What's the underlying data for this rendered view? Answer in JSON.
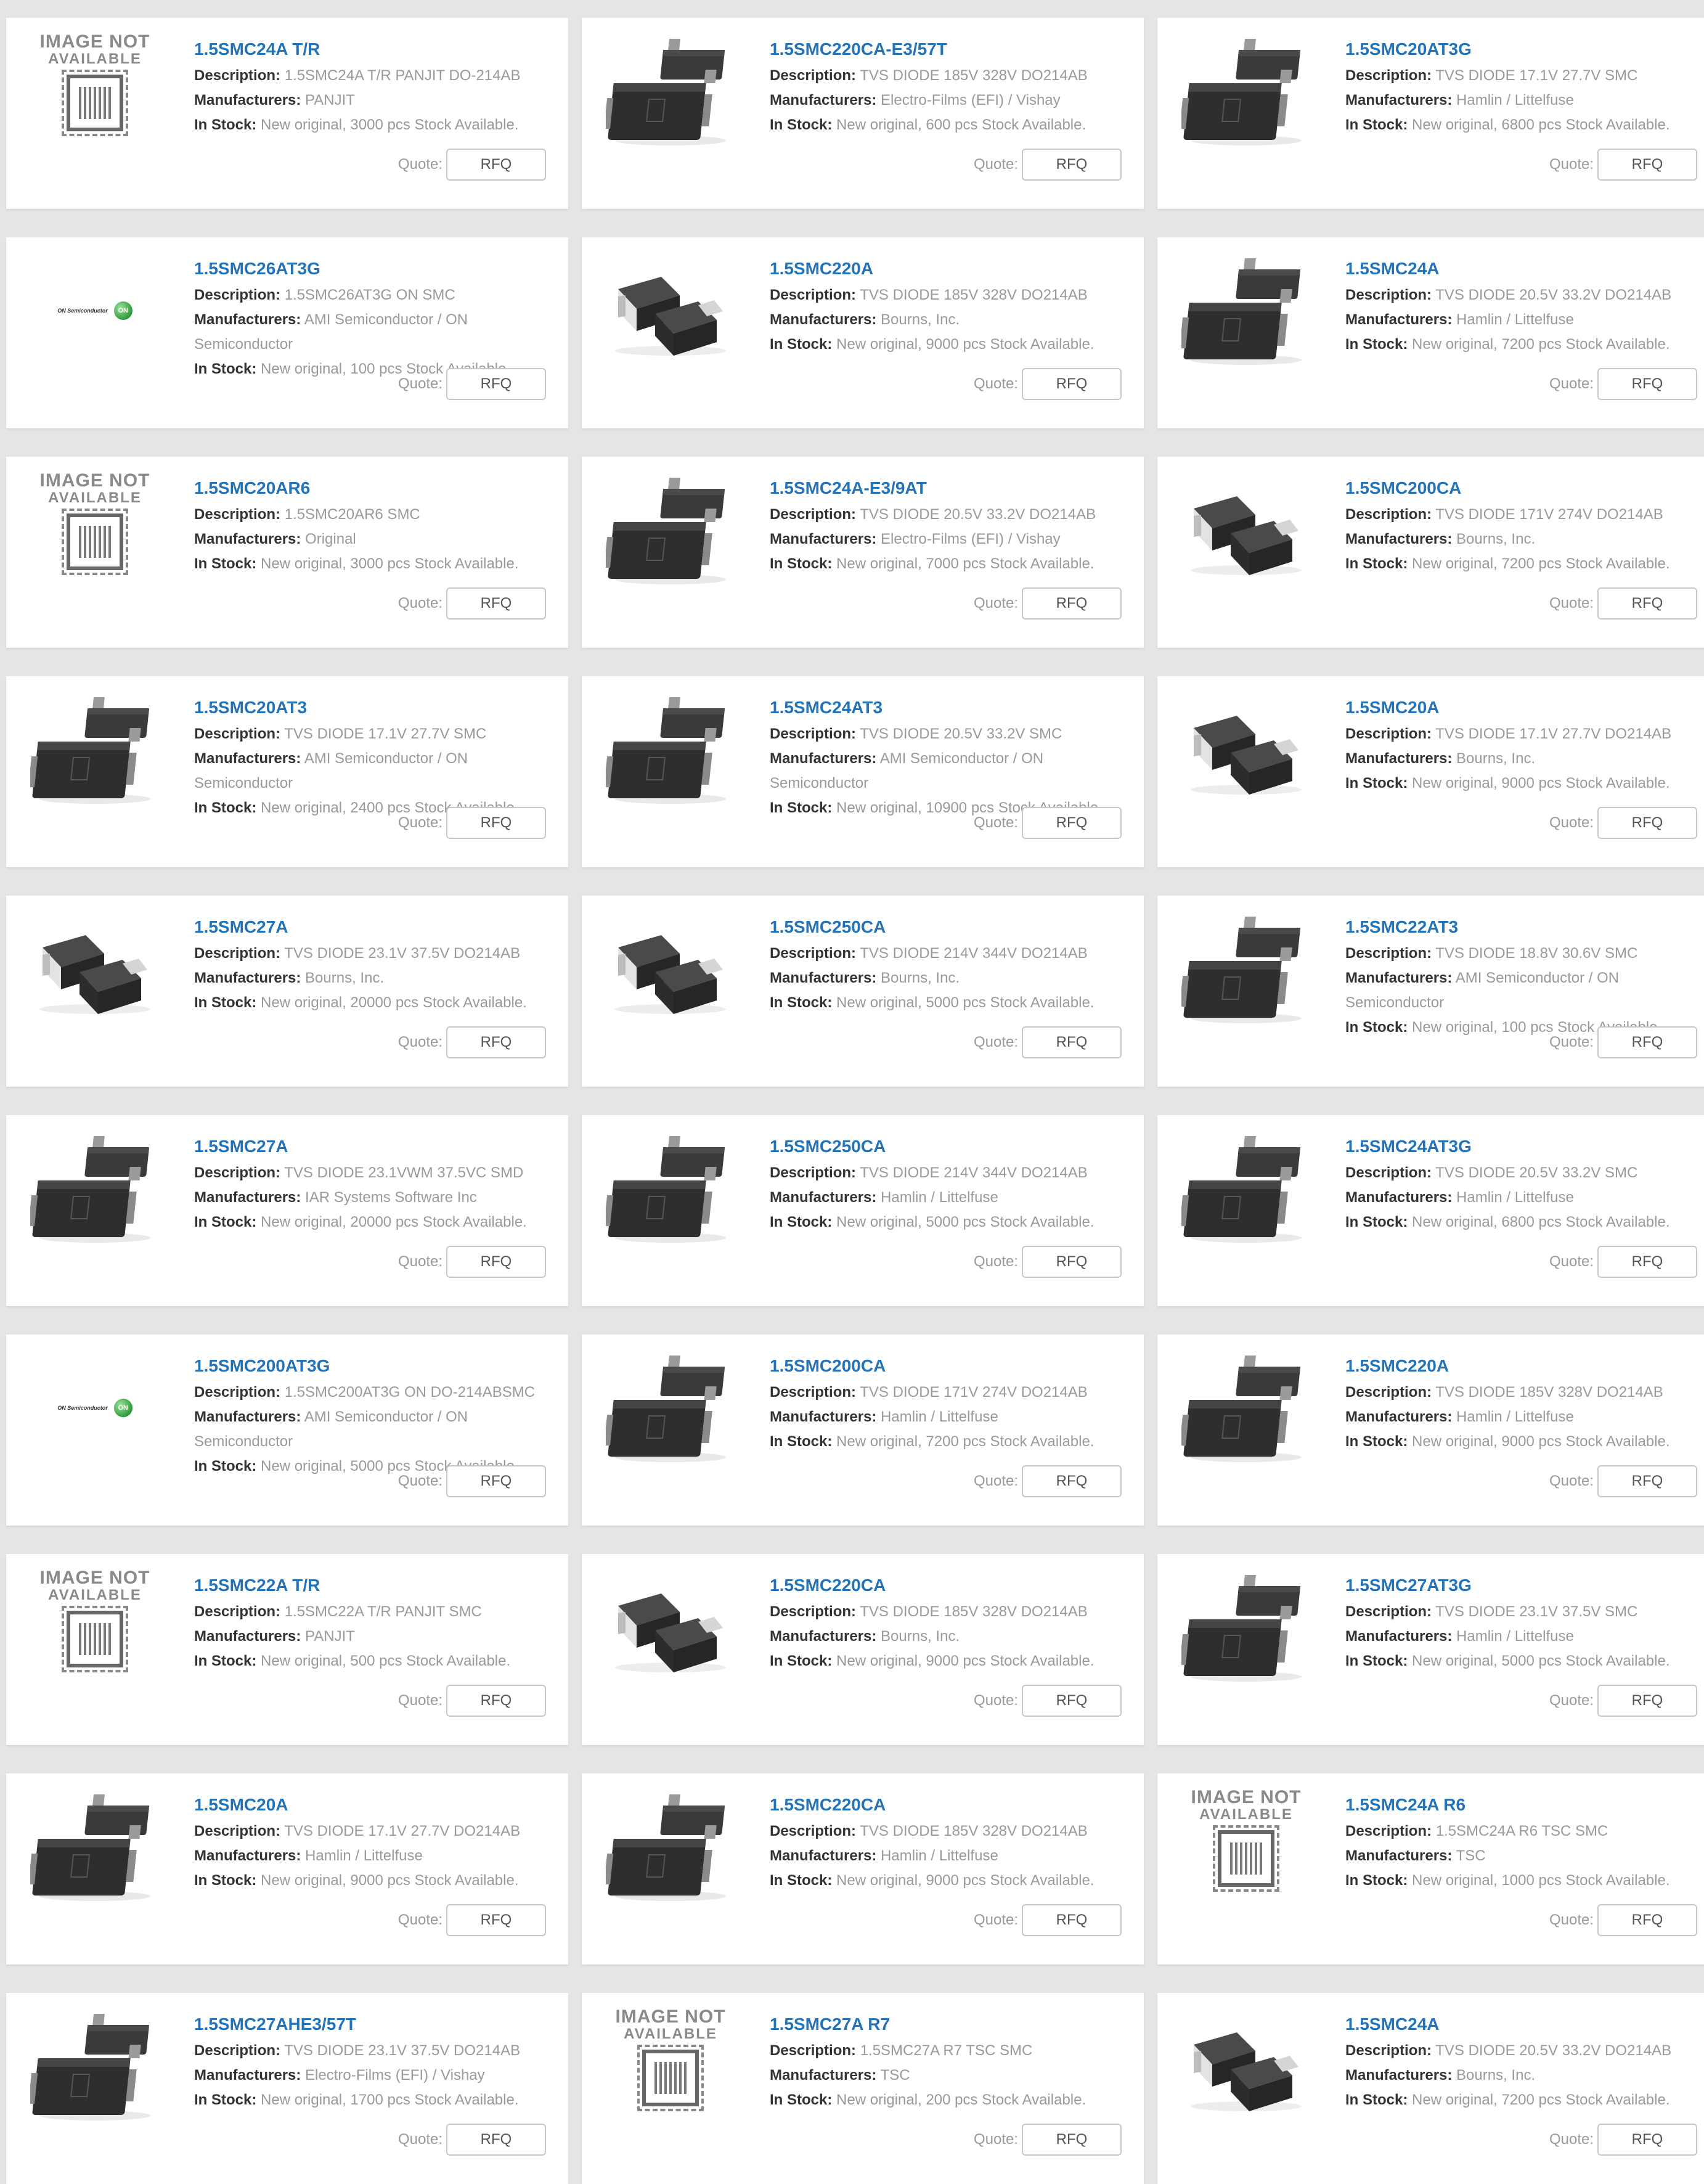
{
  "labels": {
    "description": "Description:",
    "manufacturers": "Manufacturers:",
    "in_stock": "In Stock:",
    "quote": "Quote:",
    "rfq": "RFQ",
    "image_not": "IMAGE NOT",
    "available": "AVAILABLE",
    "on_logo_text": "ON Semiconductor",
    "on_logo_mark": "ON"
  },
  "colors": {
    "accent": "#2472b8",
    "background": "#e5e5e5",
    "card": "#ffffff"
  },
  "products": [
    {
      "part": "1.5SMC24A T/R",
      "desc": "1.5SMC24A T/R PANJIT DO-214AB",
      "mfr": "PANJIT",
      "stock": "New original, 3000 pcs Stock Available.",
      "img": "na"
    },
    {
      "part": "1.5SMC220CA-E3/57T",
      "desc": "TVS DIODE 185V 328V DO214AB",
      "mfr": "Electro-Films (EFI) / Vishay",
      "stock": "New original, 600 pcs Stock Available.",
      "img": "smc-stack"
    },
    {
      "part": "1.5SMC20AT3G",
      "desc": "TVS DIODE 17.1V 27.7V SMC",
      "mfr": "Hamlin / Littelfuse",
      "stock": "New original, 6800 pcs Stock Available.",
      "img": "smc-stack"
    },
    {
      "part": "1.5SMC26AT3G",
      "desc": "1.5SMC26AT3G ON SMC",
      "mfr": "AMI Semiconductor / ON Semiconductor",
      "stock": "New original, 100 pcs Stock Available.",
      "img": "logo"
    },
    {
      "part": "1.5SMC220A",
      "desc": "TVS DIODE 185V 328V DO214AB",
      "mfr": "Bourns, Inc.",
      "stock": "New original, 9000 pcs Stock Available.",
      "img": "smc-pair"
    },
    {
      "part": "1.5SMC24A",
      "desc": "TVS DIODE 20.5V 33.2V DO214AB",
      "mfr": "Hamlin / Littelfuse",
      "stock": "New original, 7200 pcs Stock Available.",
      "img": "smc-stack"
    },
    {
      "part": "1.5SMC20AR6",
      "desc": "1.5SMC20AR6  SMC",
      "mfr": "Original",
      "stock": "New original, 3000 pcs Stock Available.",
      "img": "na"
    },
    {
      "part": "1.5SMC24A-E3/9AT",
      "desc": "TVS DIODE 20.5V 33.2V DO214AB",
      "mfr": "Electro-Films (EFI) / Vishay",
      "stock": "New original, 7000 pcs Stock Available.",
      "img": "smc-stack"
    },
    {
      "part": "1.5SMC200CA",
      "desc": "TVS DIODE 171V 274V DO214AB",
      "mfr": "Bourns, Inc.",
      "stock": "New original, 7200 pcs Stock Available.",
      "img": "smc-pair"
    },
    {
      "part": "1.5SMC20AT3",
      "desc": "TVS DIODE 17.1V 27.7V SMC",
      "mfr": "AMI Semiconductor / ON Semiconductor",
      "stock": "New original, 2400 pcs Stock Available.",
      "img": "smc-stack"
    },
    {
      "part": "1.5SMC24AT3",
      "desc": "TVS DIODE 20.5V 33.2V SMC",
      "mfr": "AMI Semiconductor / ON Semiconductor",
      "stock": "New original, 10900 pcs Stock Available.",
      "img": "smc-stack"
    },
    {
      "part": "1.5SMC20A",
      "desc": "TVS DIODE 17.1V 27.7V DO214AB",
      "mfr": "Bourns, Inc.",
      "stock": "New original, 9000 pcs Stock Available.",
      "img": "smc-pair"
    },
    {
      "part": "1.5SMC27A",
      "desc": "TVS DIODE 23.1V 37.5V DO214AB",
      "mfr": "Bourns, Inc.",
      "stock": "New original, 20000 pcs Stock Available.",
      "img": "smc-pair"
    },
    {
      "part": "1.5SMC250CA",
      "desc": "TVS DIODE 214V 344V DO214AB",
      "mfr": "Bourns, Inc.",
      "stock": "New original, 5000 pcs Stock Available.",
      "img": "smc-pair"
    },
    {
      "part": "1.5SMC22AT3",
      "desc": "TVS DIODE 18.8V 30.6V SMC",
      "mfr": "AMI Semiconductor / ON Semiconductor",
      "stock": "New original, 100 pcs Stock Available.",
      "img": "smc-stack"
    },
    {
      "part": "1.5SMC27A",
      "desc": "TVS DIODE 23.1VWM 37.5VC SMD",
      "mfr": "IAR Systems Software Inc",
      "stock": "New original, 20000 pcs Stock Available.",
      "img": "smc-stack"
    },
    {
      "part": "1.5SMC250CA",
      "desc": "TVS DIODE 214V 344V DO214AB",
      "mfr": "Hamlin / Littelfuse",
      "stock": "New original, 5000 pcs Stock Available.",
      "img": "smc-stack"
    },
    {
      "part": "1.5SMC24AT3G",
      "desc": "TVS DIODE 20.5V 33.2V SMC",
      "mfr": "Hamlin / Littelfuse",
      "stock": "New original, 6800 pcs Stock Available.",
      "img": "smc-stack"
    },
    {
      "part": "1.5SMC200AT3G",
      "desc": "1.5SMC200AT3G ON DO-214ABSMC",
      "mfr": "AMI Semiconductor / ON Semiconductor",
      "stock": "New original, 5000 pcs Stock Available.",
      "img": "logo"
    },
    {
      "part": "1.5SMC200CA",
      "desc": "TVS DIODE 171V 274V DO214AB",
      "mfr": "Hamlin / Littelfuse",
      "stock": "New original, 7200 pcs Stock Available.",
      "img": "smc-stack"
    },
    {
      "part": "1.5SMC220A",
      "desc": "TVS DIODE 185V 328V DO214AB",
      "mfr": "Hamlin / Littelfuse",
      "stock": "New original, 9000 pcs Stock Available.",
      "img": "smc-stack"
    },
    {
      "part": "1.5SMC22A T/R",
      "desc": "1.5SMC22A T/R PANJIT SMC",
      "mfr": "PANJIT",
      "stock": "New original, 500 pcs Stock Available.",
      "img": "na"
    },
    {
      "part": "1.5SMC220CA",
      "desc": "TVS DIODE 185V 328V DO214AB",
      "mfr": "Bourns, Inc.",
      "stock": "New original, 9000 pcs Stock Available.",
      "img": "smc-pair"
    },
    {
      "part": "1.5SMC27AT3G",
      "desc": "TVS DIODE 23.1V 37.5V SMC",
      "mfr": "Hamlin / Littelfuse",
      "stock": "New original, 5000 pcs Stock Available.",
      "img": "smc-stack"
    },
    {
      "part": "1.5SMC20A",
      "desc": "TVS DIODE 17.1V 27.7V DO214AB",
      "mfr": "Hamlin / Littelfuse",
      "stock": "New original, 9000 pcs Stock Available.",
      "img": "smc-stack"
    },
    {
      "part": "1.5SMC220CA",
      "desc": "TVS DIODE 185V 328V DO214AB",
      "mfr": "Hamlin / Littelfuse",
      "stock": "New original, 9000 pcs Stock Available.",
      "img": "smc-stack"
    },
    {
      "part": "1.5SMC24A R6",
      "desc": "1.5SMC24A R6 TSC SMC",
      "mfr": "TSC",
      "stock": "New original, 1000 pcs Stock Available.",
      "img": "na"
    },
    {
      "part": "1.5SMC27AHE3/57T",
      "desc": "TVS DIODE 23.1V 37.5V DO214AB",
      "mfr": "Electro-Films (EFI) / Vishay",
      "stock": "New original, 1700 pcs Stock Available.",
      "img": "smc-stack"
    },
    {
      "part": "1.5SMC27A R7",
      "desc": "1.5SMC27A R7 TSC SMC",
      "mfr": "TSC",
      "stock": "New original, 200 pcs Stock Available.",
      "img": "na"
    },
    {
      "part": "1.5SMC24A",
      "desc": "TVS DIODE 20.5V 33.2V DO214AB",
      "mfr": "Bourns, Inc.",
      "stock": "New original, 7200 pcs Stock Available.",
      "img": "smc-pair"
    }
  ]
}
